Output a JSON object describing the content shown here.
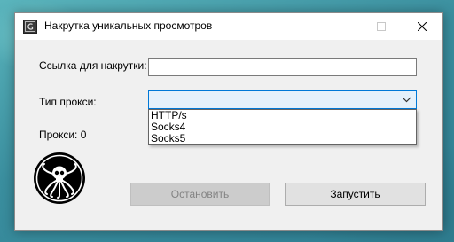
{
  "window": {
    "title": "Накрутка уникальных просмотров"
  },
  "form": {
    "link_label": "Ссылка для накрутки:",
    "link_value": "",
    "proxy_type_label": "Тип прокси:",
    "proxy_type_selected": "",
    "proxy_type_options": [
      "HTTP/s",
      "Socks4",
      "Socks5"
    ],
    "proxy_count_label": "Прокси: 0"
  },
  "buttons": {
    "stop_label": "Остановить",
    "start_label": "Запустить"
  },
  "colors": {
    "combo_focus_border": "#0078d7",
    "combo_background": "#e5f1fb",
    "disabled_button": "#cccccc",
    "button": "#e1e1e1"
  },
  "icons": {
    "app": "app-icon",
    "minimize": "minimize-icon",
    "maximize": "maximize-icon",
    "close": "close-icon",
    "dropdown": "chevron-down-icon",
    "logo": "skull-octopus-logo"
  }
}
